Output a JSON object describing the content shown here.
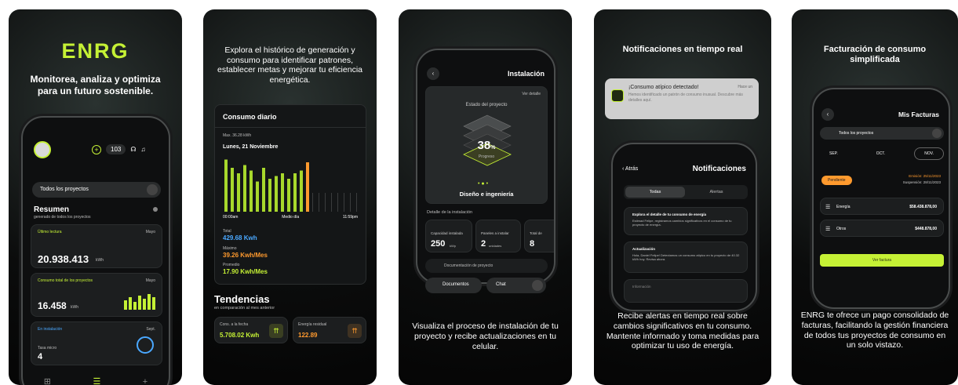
{
  "p1": {
    "logo": "ENRG",
    "caption": "Monitorea, analiza y optimiza para un futuro sostenible.",
    "coins": "103",
    "project_select": "Todos los proyectos",
    "summary_title": "Resumen",
    "summary_sub": "generado de todos los proyectos",
    "c1_label": "Último lectura",
    "c1_tag": "Mayo",
    "c1_value": "20.938.413",
    "c1_unit": "kWh",
    "c2_label": "Consumo total de los proyectos",
    "c2_tag": "Mayo",
    "c2_value": "16.458",
    "c2_unit": "kWh",
    "c3_label": "En instalación",
    "c3_tag": "Sept.",
    "c3_sub": "Tasa micro",
    "c3_value": "4",
    "nav": [
      "⊞",
      "☰",
      "+"
    ]
  },
  "p2": {
    "caption": "Explora el histórico de generación y consumo para identificar patrones, establecer metas y mejorar tu eficiencia energética.",
    "card_title": "Consumo diario",
    "max_line": "Max. 36.28 kWh",
    "date": "Lunes, 21 Noviembre",
    "t1": "00:00am",
    "t2": "Medio día",
    "t3": "11:59pm",
    "total_label": "Total",
    "total_value": "429.68 Kwh",
    "max_label": "Máximo",
    "max_value": "39.26 Kwh/Mes",
    "avg_label": "Promedio",
    "avg_value": "17.90 Kwh/Mes",
    "trend_title": "Tendencias",
    "trend_sub": "en comparación al mes anterior",
    "trend1_label": "Cons. a la fecha",
    "trend1_value": "5.708.02 Kwh",
    "trend2_label": "Energía residual",
    "trend2_value": "122.89"
  },
  "p3": {
    "caption": "Visualiza el proceso de instalación de tu proyecto y recibe actualizaciones en tu celular.",
    "title": "Instalación",
    "ver_detalle": "Ver detalle",
    "estado": "Estado del proyecto",
    "percent": "38",
    "percent_sign": "%",
    "progreso": "Progreso",
    "stage": "Diseño e ingeniería",
    "detalle": "Detalle de la instalación",
    "s1_label": "Capacidad instalada",
    "s1_value": "250",
    "s1_unit": "kWp",
    "s2_label": "Paneles a instalar",
    "s2_value": "2",
    "s2_unit": "unidades",
    "s3_label": "Total de",
    "s3_value": "8",
    "proyecto_field": "Documentación de proyecto",
    "docs": "Documentos",
    "chat": "Chat"
  },
  "p4": {
    "caption_top": "Notificaciones en tiempo real",
    "banner_title": "¡Consumo atípico detectado!",
    "banner_time": "Hace un",
    "banner_text": "Hemos identificado un patrón de consumo inusual. Descubre más detalles aquí.",
    "back": "Atrás",
    "title": "Notificaciones",
    "tab1": "Todas",
    "tab2": "Alertas",
    "n1_title": "Explora el detalle de tu consumo de energía",
    "n1_text": "Estimad Felipe, registramos cambios significativos en el consumo de tu proyecto de energía.",
    "n2_title": "Actualización",
    "n2_text": "Hola, Daniel Felipe! Detectamos un consumo atípico en tu proyecto de 40.32 kWh hoy. Revisa ahora.",
    "n3_title": "Información",
    "caption": "Recibe alertas en tiempo real sobre cambios significativos en tu consumo. Mantente informado y toma medidas para optimizar tu uso de energía."
  },
  "p5": {
    "caption_top": "Facturación de consumo simplificada",
    "title": "Mis Facturas",
    "select": "Todos los proyectos",
    "m1": "SEP.",
    "m2": "OCT.",
    "m3": "NOV.",
    "status": "Pendiente",
    "emision": "Emisión: 25/11/2023",
    "suspension": "Suspensión: 28/11/2023",
    "l1_label": "Energía",
    "l1_value": "$58.438.878,00",
    "l2_label": "Otros",
    "l2_value": "$448.878,00",
    "button": "Ver factura",
    "caption": "ENRG te ofrece un pago consolidado de facturas, facilitando la gestión financiera de todos tus proyectos de consumo en un solo vistazo."
  },
  "chart_data": {
    "type": "bar",
    "series": [
      {
        "values": [
          0.95,
          0.8,
          0.7,
          0.85,
          0.75,
          0.55,
          0.8,
          0.6,
          0.65,
          0.7,
          0.6,
          0.7,
          0.75,
          0.9
        ]
      }
    ]
  }
}
